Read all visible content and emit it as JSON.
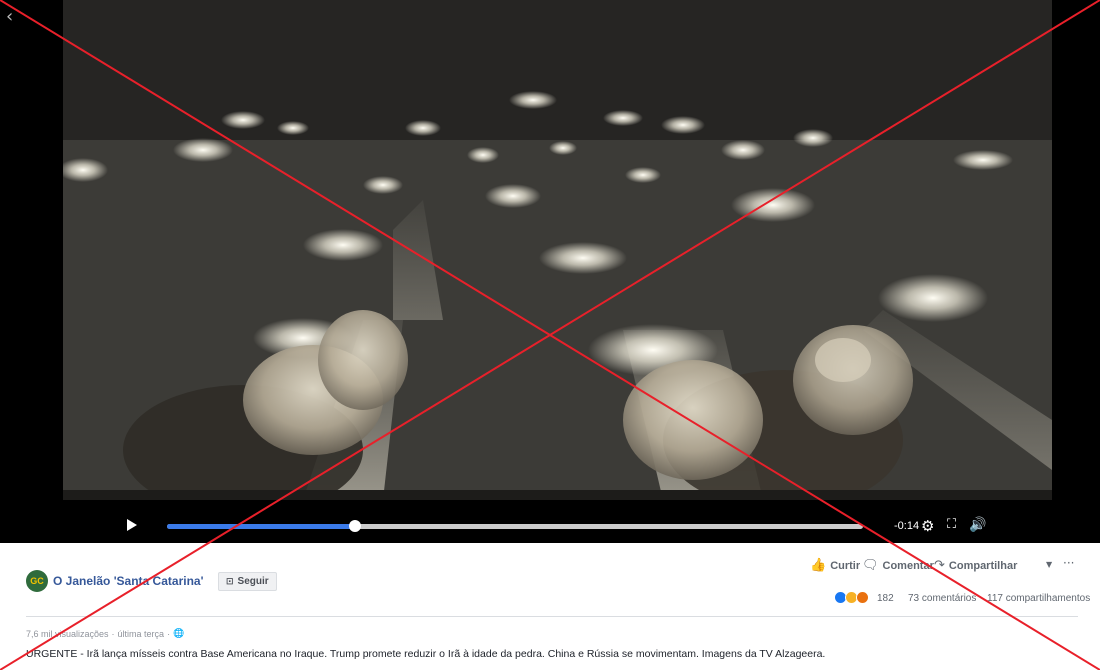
{
  "video": {
    "time_remaining": "-0:14",
    "progress": 0.27
  },
  "page": {
    "avatar_text": "GC",
    "name": "O Janelão 'Santa Catarina'",
    "follow_label": "Seguir"
  },
  "actions": {
    "like_label": "Curtir",
    "comment_label": "Comentar",
    "share_label": "Compartilhar"
  },
  "stats": {
    "reactions_count": "182",
    "comments": "73 comentários",
    "shares": "117 compartilhamentos"
  },
  "post": {
    "views": "7,6 mil visualizações",
    "separator": "·",
    "date": "última terça",
    "caption": "URGENTE - Irã lança mísseis contra Base Americana no Iraque. Trump promete reduzir o Irã à idade da pedra. China e Rússia se movimentam. Imagens da TV Alzageera."
  },
  "colors": {
    "progress": "#3b7bea",
    "link": "#365899",
    "false_mark": "#e8202a"
  }
}
